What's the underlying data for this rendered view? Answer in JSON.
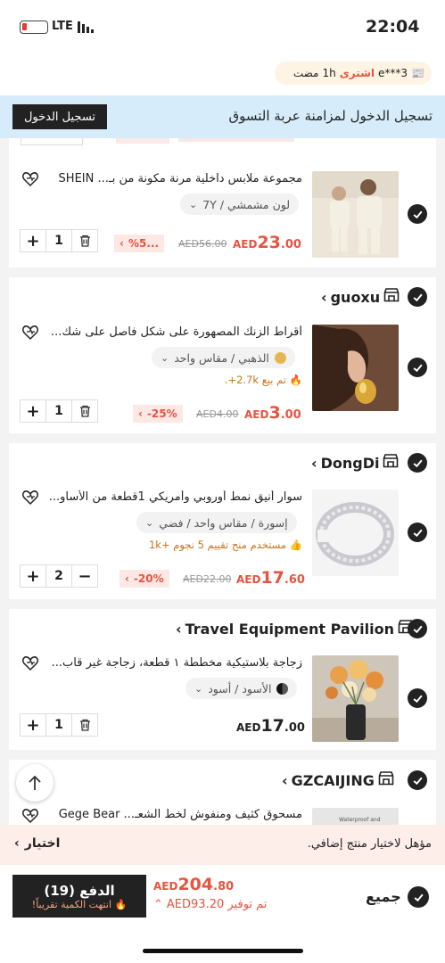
{
  "status_bar": {
    "time": "22:04",
    "network": "LTE"
  },
  "activity": {
    "user": "e***3",
    "action": "اشترى",
    "ago": "1h",
    "suffix": "مضت"
  },
  "sync_banner": {
    "text": "تسجيل الدخول لمزامنة عربة التسوق",
    "button": "تسجيل الدخول"
  },
  "items": [
    {
      "title": "مجموعة ملابس داخلية مرنة مكونة من بـ... SHEIN",
      "variant": "لون مشمشي / 7Y",
      "qty": "1",
      "discount": "%5...",
      "old_price": "AED56.00",
      "price_cur": "AED",
      "price_int": "23",
      "price_dec": ".00"
    },
    {
      "store": "guoxu",
      "title": "أقراط الزنك المصهورة على شكل فاصل على شك...",
      "variant": "الذهبي / مقاس واحد",
      "meta": "تم بيع 2.7k+.",
      "qty": "1",
      "discount": "-25%",
      "old_price": "AED4.00",
      "price_cur": "AED",
      "price_int": "3",
      "price_dec": ".00"
    },
    {
      "store": "DongDi",
      "title": "سوار أنيق نمط أوروبي وأمريكي 1قطعة من الأساو...",
      "variant": "إسورة / مقاس واحد / فضي",
      "meta": "مستخدم منح تقييم 5 نجوم +1k",
      "qty": "2",
      "discount": "-20%",
      "old_price": "AED22.00",
      "price_cur": "AED",
      "price_int": "17",
      "price_dec": ".60"
    },
    {
      "store": "Travel Equipment Pavilion",
      "title": "زجاجة بلاستيكية مخططة ١ قطعة، زجاجة غير قاب...",
      "variant": "الأسود / أسود",
      "qty": "1",
      "price_cur": "AED",
      "price_int": "17",
      "price_dec": ".00"
    },
    {
      "store": "GZCAIJING",
      "title": "مسحوق كثيف ومنفوش لخط الشعـ... Gege Bear",
      "thumb_text": "Waterproof and"
    }
  ],
  "promo_bar": {
    "text": "مؤهل لاختيار منتج إضافي.",
    "action": "اختيار"
  },
  "footer": {
    "select_all": "جميع",
    "total_cur": "AED",
    "total_int": "204",
    "total_dec": ".80",
    "savings": "تم توفير AED93.20",
    "pay_label": "الدفع (19)",
    "stock_warning": "انتهت الكمية تقريباً!"
  },
  "colors": {
    "accent": "#e8533f",
    "banner": "#d7ecfb",
    "dark": "#222222"
  }
}
